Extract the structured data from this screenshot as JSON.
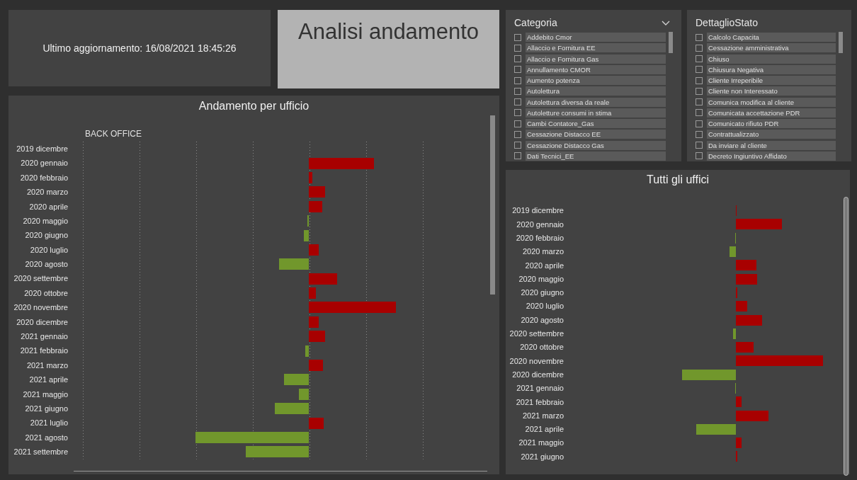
{
  "header": {
    "last_update": "Ultimo aggiornamento: 16/08/2021 18:45:26"
  },
  "title": "Analisi andamento",
  "slicers": [
    {
      "title": "Categoria",
      "dropdown": true,
      "items": [
        {
          "label": "Addebito Cmor",
          "checked": false
        },
        {
          "label": "Allaccio e Fornitura EE",
          "checked": false
        },
        {
          "label": "Allaccio e Fornitura Gas",
          "checked": false
        },
        {
          "label": "Annullamento CMOR",
          "checked": false
        },
        {
          "label": "Aumento potenza",
          "checked": false
        },
        {
          "label": "Autolettura",
          "checked": false
        },
        {
          "label": "Autolettura diversa da reale",
          "checked": false
        },
        {
          "label": "Autoletture consumi in stima",
          "checked": false
        },
        {
          "label": "Cambi Contatore_Gas",
          "checked": false
        },
        {
          "label": "Cessazione Distacco EE",
          "checked": false
        },
        {
          "label": "Cessazione Distacco Gas",
          "checked": false
        },
        {
          "label": "Dati Tecnici_EE",
          "checked": false
        }
      ]
    },
    {
      "title": "DettaglioStato",
      "dropdown": false,
      "items": [
        {
          "label": "Calcolo Capacita",
          "checked": false
        },
        {
          "label": "Cessazione amministrativa",
          "checked": false
        },
        {
          "label": "Chiuso",
          "checked": false
        },
        {
          "label": "Chiusura Negativa",
          "checked": false
        },
        {
          "label": "Cliente Irreperibile",
          "checked": false
        },
        {
          "label": "Cliente non Interessato",
          "checked": false
        },
        {
          "label": "Comunica modifica al cliente",
          "checked": false
        },
        {
          "label": "Comunicata accettazione PDR",
          "checked": false
        },
        {
          "label": "Comunicato rifiuto PDR",
          "checked": false
        },
        {
          "label": "Contrattualizzato",
          "checked": false
        },
        {
          "label": "Da inviare al cliente",
          "checked": false
        },
        {
          "label": "Decreto Ingiuntivo Affidato",
          "checked": false
        }
      ]
    }
  ],
  "charts": [
    {
      "title": "Andamento per ufficio",
      "subtitle": "BACK OFFICE",
      "rows": [
        {
          "label": "2019 dicembre"
        },
        {
          "label": "2020 gennaio"
        },
        {
          "label": "2020 febbraio"
        },
        {
          "label": "2020 marzo"
        },
        {
          "label": "2020 aprile"
        },
        {
          "label": "2020 maggio"
        },
        {
          "label": "2020 giugno"
        },
        {
          "label": "2020 luglio"
        },
        {
          "label": "2020 agosto"
        },
        {
          "label": "2020 settembre"
        },
        {
          "label": "2020 ottobre"
        },
        {
          "label": "2020 novembre"
        },
        {
          "label": "2020 dicembre"
        },
        {
          "label": "2021 gennaio"
        },
        {
          "label": "2021 febbraio"
        },
        {
          "label": "2021 marzo"
        },
        {
          "label": "2021 aprile"
        },
        {
          "label": "2021 maggio"
        },
        {
          "label": "2021 giugno"
        },
        {
          "label": "2021 luglio"
        },
        {
          "label": "2021 agosto"
        },
        {
          "label": "2021 settembre"
        }
      ]
    },
    {
      "title": "Tutti gli uffici",
      "rows": [
        {
          "label": "2019 dicembre"
        },
        {
          "label": "2020 gennaio"
        },
        {
          "label": "2020 febbraio"
        },
        {
          "label": "2020 marzo"
        },
        {
          "label": "2020 aprile"
        },
        {
          "label": "2020 maggio"
        },
        {
          "label": "2020 giugno"
        },
        {
          "label": "2020 luglio"
        },
        {
          "label": "2020 agosto"
        },
        {
          "label": "2020 settembre"
        },
        {
          "label": "2020 ottobre"
        },
        {
          "label": "2020 novembre"
        },
        {
          "label": "2020 dicembre"
        },
        {
          "label": "2021 gennaio"
        },
        {
          "label": "2021 febbraio"
        },
        {
          "label": "2021 marzo"
        },
        {
          "label": "2021 aprile"
        },
        {
          "label": "2021 maggio"
        },
        {
          "label": "2021 giugno"
        }
      ]
    }
  ]
}
